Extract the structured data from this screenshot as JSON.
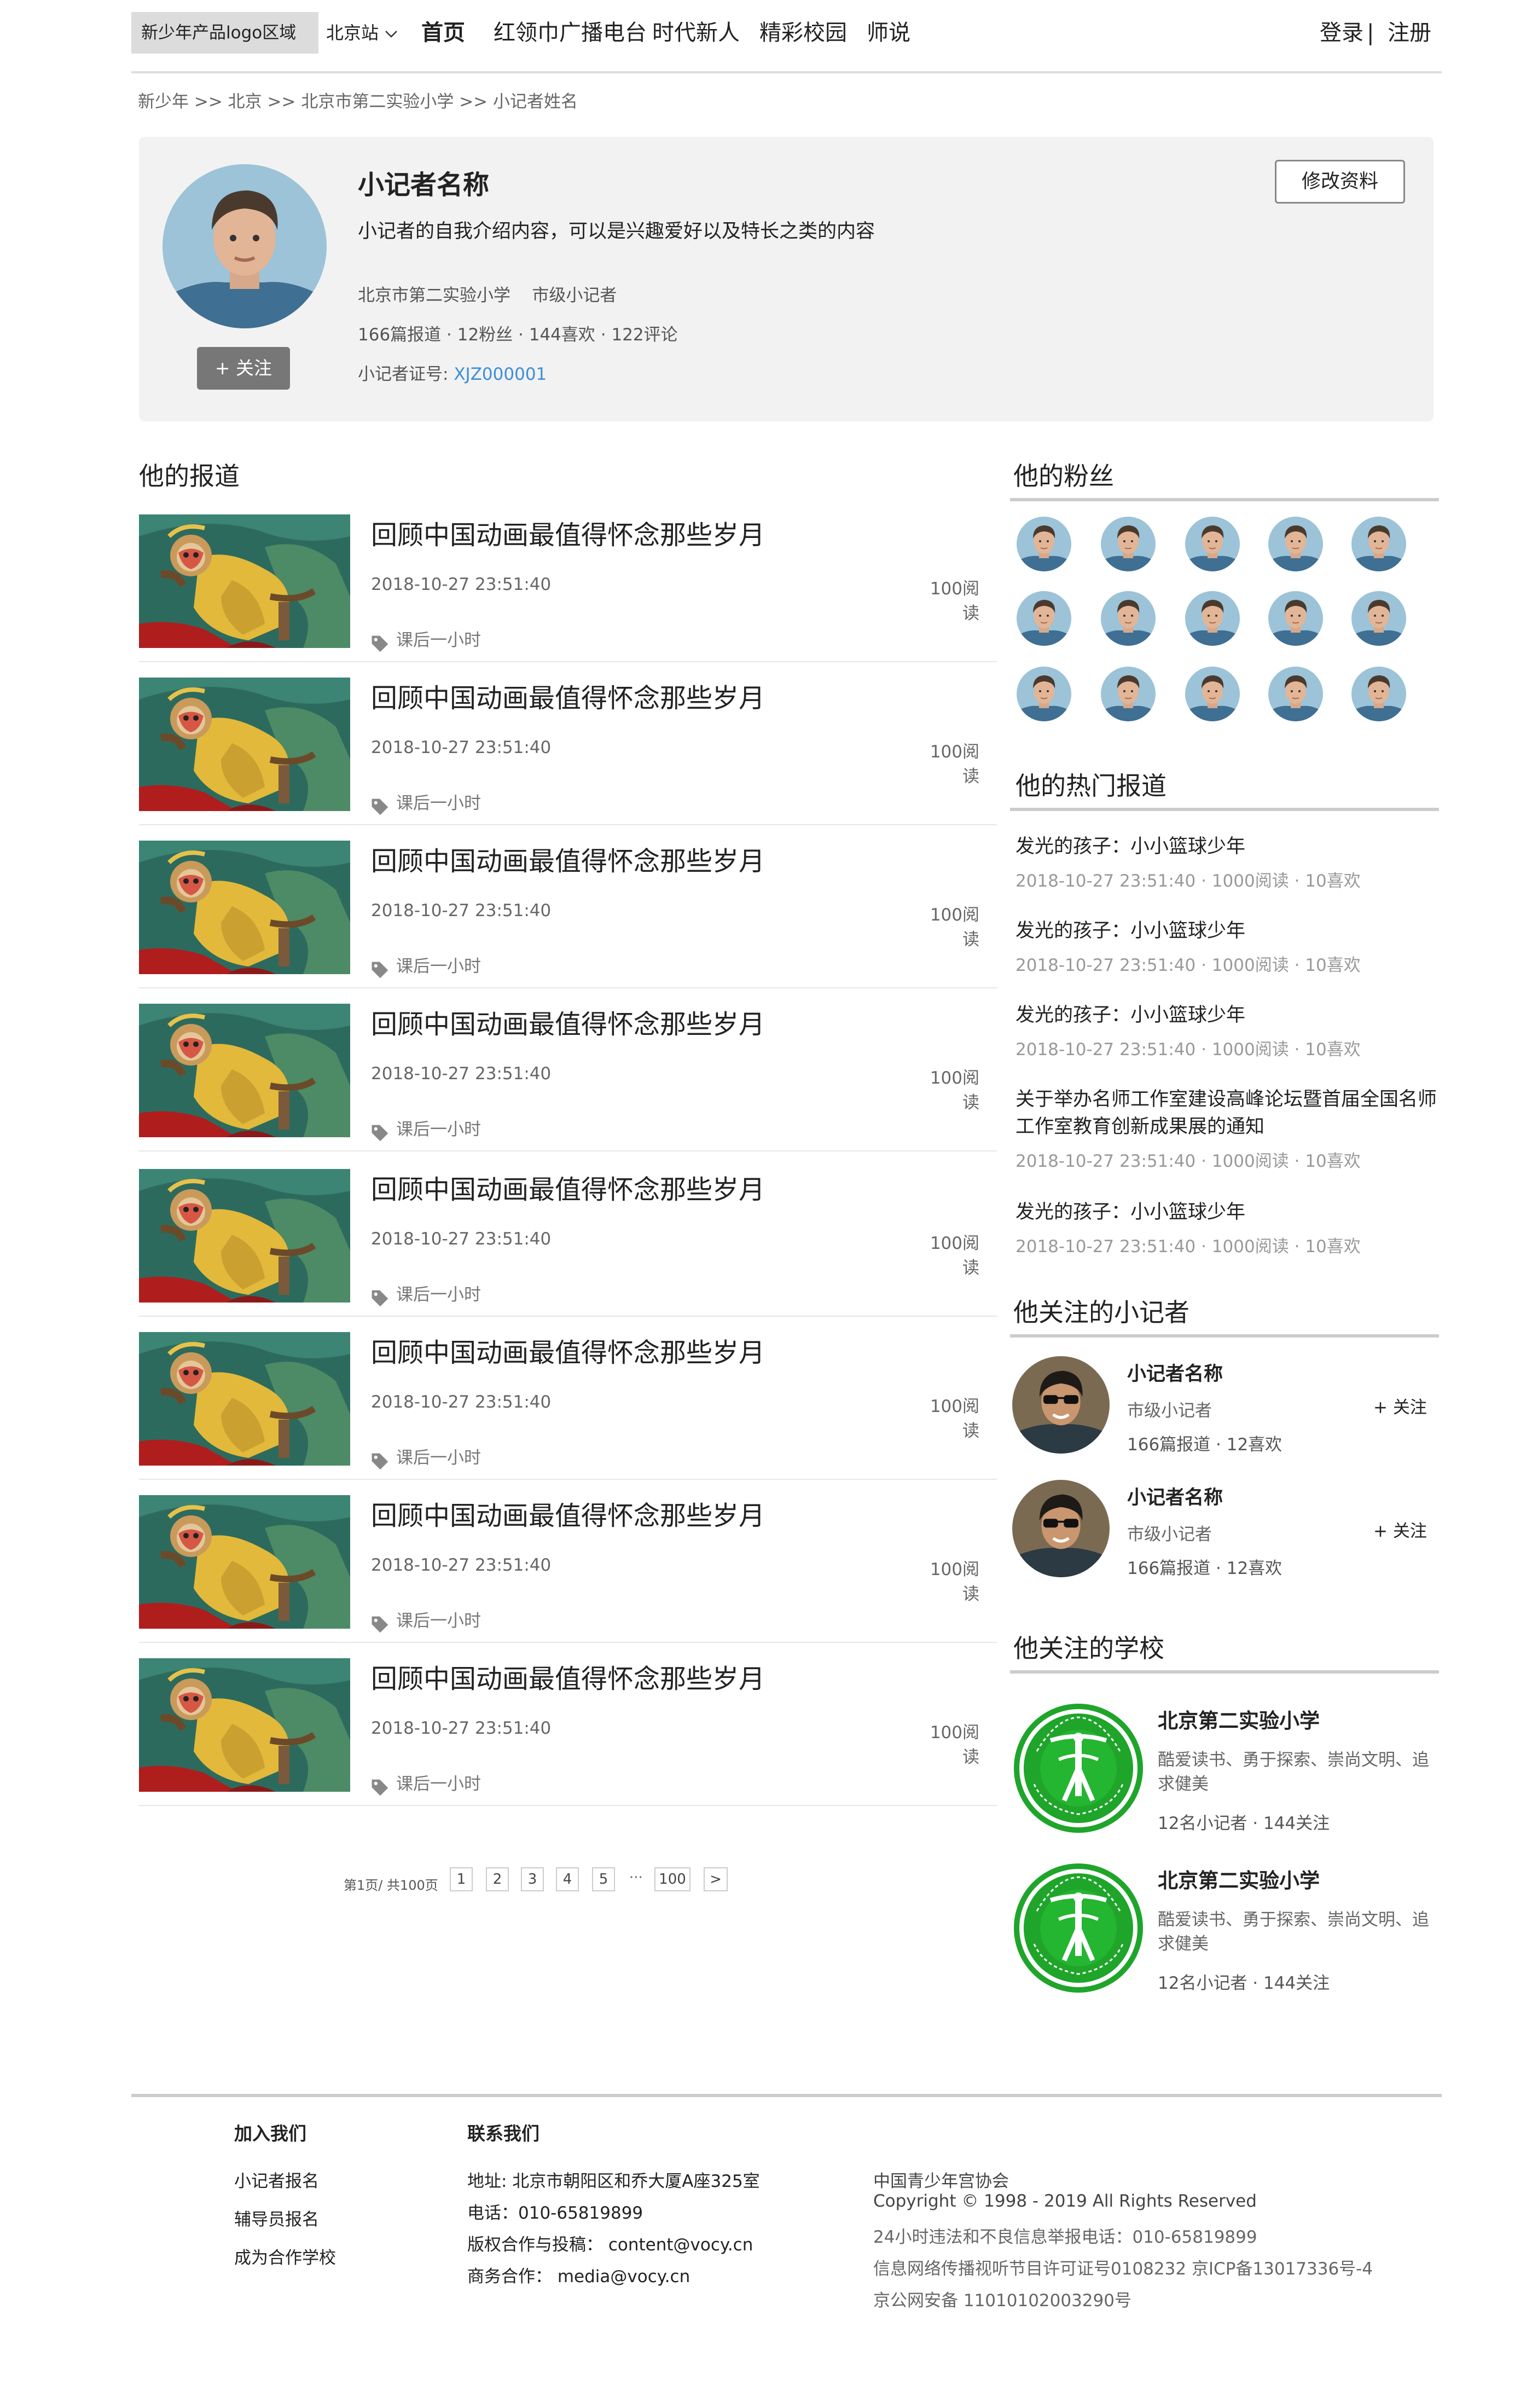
{
  "header": {
    "logo_text": "新少年产品logo区域",
    "city": "北京站",
    "nav": [
      "首页",
      "红领巾广播电台",
      "时代新人",
      "精彩校园",
      "师说"
    ],
    "login": "登录",
    "divider": "|",
    "register": "注册"
  },
  "breadcrumb": [
    "新少年",
    ">>",
    "北京",
    ">>",
    "北京市第二实验小学",
    ">>",
    "小记者姓名"
  ],
  "profile": {
    "name": "小记者名称",
    "intro": "小记者的自我介绍内容，可以是兴趣爱好以及特长之类的内容",
    "school": "北京市第二实验小学",
    "level": "市级小记者",
    "stats": "166篇报道 · 12粉丝 · 144喜欢 ·  122评论",
    "id_label": "小记者证号:",
    "id_value": "XJZ000001",
    "follow_label": "+ 关注",
    "edit_label": "修改资料"
  },
  "reports": {
    "title": "他的报道",
    "items": [
      {
        "title": "回顾中国动画最值得怀念那些岁月",
        "date": "2018-10-27 23:51:40",
        "reads": "100阅读",
        "tag": "课后一小时"
      },
      {
        "title": "回顾中国动画最值得怀念那些岁月",
        "date": "2018-10-27 23:51:40",
        "reads": "100阅读",
        "tag": "课后一小时"
      },
      {
        "title": "回顾中国动画最值得怀念那些岁月",
        "date": "2018-10-27 23:51:40",
        "reads": "100阅读",
        "tag": "课后一小时"
      },
      {
        "title": "回顾中国动画最值得怀念那些岁月",
        "date": "2018-10-27 23:51:40",
        "reads": "100阅读",
        "tag": "课后一小时"
      },
      {
        "title": "回顾中国动画最值得怀念那些岁月",
        "date": "2018-10-27 23:51:40",
        "reads": "100阅读",
        "tag": "课后一小时"
      },
      {
        "title": "回顾中国动画最值得怀念那些岁月",
        "date": "2018-10-27 23:51:40",
        "reads": "100阅读",
        "tag": "课后一小时"
      },
      {
        "title": "回顾中国动画最值得怀念那些岁月",
        "date": "2018-10-27 23:51:40",
        "reads": "100阅读",
        "tag": "课后一小时"
      },
      {
        "title": "回顾中国动画最值得怀念那些岁月",
        "date": "2018-10-27 23:51:40",
        "reads": "100阅读",
        "tag": "课后一小时"
      }
    ]
  },
  "pagination": {
    "info": "第1页/ 共100页",
    "pages": [
      "1",
      "2",
      "3",
      "4",
      "5"
    ],
    "ellipsis": "···",
    "last": "100",
    "next": ">"
  },
  "fans": {
    "title": "他的粉丝"
  },
  "hot": {
    "title": "他的热门报道",
    "items": [
      {
        "title": "发光的孩子：小小篮球少年",
        "meta": "2018-10-27 23:51:40  · 1000阅读 · 10喜欢"
      },
      {
        "title": "发光的孩子：小小篮球少年",
        "meta": "2018-10-27 23:51:40  · 1000阅读 · 10喜欢"
      },
      {
        "title": "发光的孩子：小小篮球少年",
        "meta": "2018-10-27 23:51:40  · 1000阅读 · 10喜欢"
      },
      {
        "title": "关于举办名师工作室建设高峰论坛暨首届全国名师工作室教育创新成果展的通知",
        "meta": "2018-10-27 23:51:40  · 1000阅读 · 10喜欢"
      },
      {
        "title": "发光的孩子：小小篮球少年",
        "meta": "2018-10-27 23:51:40  · 1000阅读 · 10喜欢"
      }
    ]
  },
  "following": {
    "title": "他关注的小记者",
    "items": [
      {
        "name": "小记者名称",
        "level": "市级小记者",
        "stats": "166篇报道 · 12喜欢",
        "follow": "+ 关注"
      },
      {
        "name": "小记者名称",
        "level": "市级小记者",
        "stats": "166篇报道 · 12喜欢",
        "follow": "+ 关注"
      }
    ]
  },
  "schools": {
    "title": "他关注的学校",
    "items": [
      {
        "name": "北京第二实验小学",
        "desc": "酷爱读书、勇于探索、崇尚文明、追求健美",
        "stats": "12名小记者 · 144关注"
      },
      {
        "name": "北京第二实验小学",
        "desc": "酷爱读书、勇于探索、崇尚文明、追求健美",
        "stats": "12名小记者 · 144关注"
      }
    ]
  },
  "footer": {
    "join": {
      "title": "加入我们",
      "items": [
        "小记者报名",
        "辅导员报名",
        "成为合作学校"
      ]
    },
    "contact": {
      "title": "联系我们",
      "items": [
        "地址: 北京市朝阳区和乔大厦A座325室",
        "电话：010-65819899",
        "版权合作与投稿：  content@vocy.cn",
        "商务合作：  media@vocy.cn"
      ]
    },
    "org": "中国青少年宫协会",
    "copyright": "Copyright © 1998 - 2019 All Rights Reserved",
    "legal": [
      "24小时违法和不良信息举报电话：010-65819899",
      "信息网络传播视听节目许可证号0108232 京ICP备13017336号-4",
      "京公网安备 11010102003290号"
    ]
  },
  "colors": {
    "accent_blue": "#3b8ed8",
    "school_green": "#1ea52a",
    "card_bg": "#f2f2f2"
  }
}
